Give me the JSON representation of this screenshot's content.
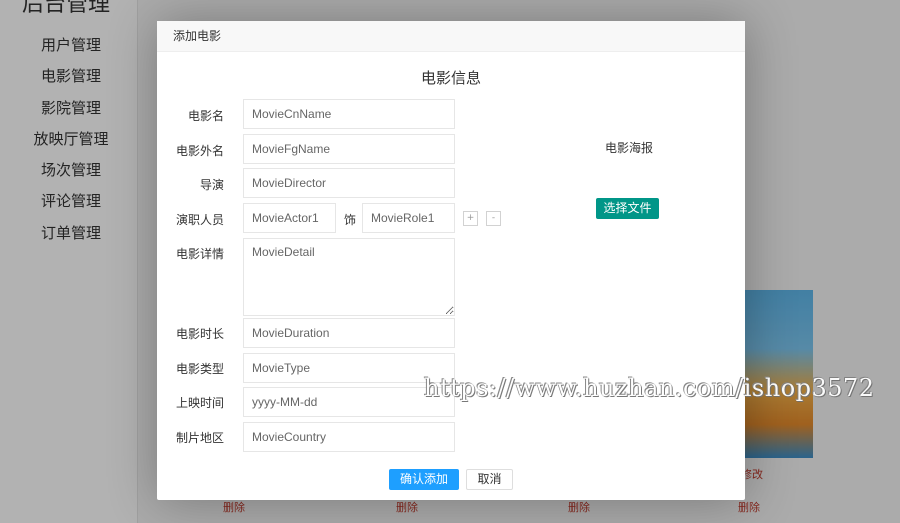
{
  "background": {
    "brand": "后台管理",
    "menu": [
      "用户管理",
      "电影管理",
      "影院管理",
      "放映厅管理",
      "场次管理",
      "评论管理",
      "订单管理"
    ],
    "partial_links": [
      "修改",
      "删除",
      "删除",
      "删除",
      "删除"
    ]
  },
  "modal": {
    "header_title": "添加电影",
    "form_title": "电影信息",
    "fields": {
      "cn_name": {
        "label": "电影名",
        "placeholder": "MovieCnName"
      },
      "fg_name": {
        "label": "电影外名",
        "placeholder": "MovieFgName"
      },
      "director": {
        "label": "导演",
        "placeholder": "MovieDirector"
      },
      "actor": {
        "label": "演职人员",
        "placeholder": "MovieActor1",
        "separator": "饰",
        "role_placeholder": "MovieRole1",
        "add": "+",
        "remove": "-"
      },
      "detail": {
        "label": "电影详情",
        "placeholder": "MovieDetail"
      },
      "duration": {
        "label": "电影时长",
        "placeholder": "MovieDuration"
      },
      "type": {
        "label": "电影类型",
        "placeholder": "MovieType"
      },
      "release": {
        "label": "上映时间",
        "placeholder": "yyyy-MM-dd"
      },
      "country": {
        "label": "制片地区",
        "placeholder": "MovieCountry"
      }
    },
    "poster": {
      "label": "电影海报",
      "button": "选择文件"
    },
    "buttons": {
      "confirm": "确认添加",
      "cancel": "取消"
    }
  },
  "watermark": "https://www.huzhan.com/ishop3572",
  "colors": {
    "primary": "#1E9FFF",
    "upload": "#009688",
    "overlay": "rgba(0,0,0,0.3)"
  }
}
